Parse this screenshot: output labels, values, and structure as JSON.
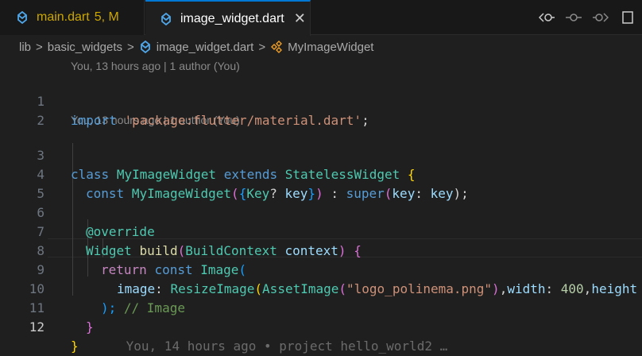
{
  "tabs": [
    {
      "name": "main.dart",
      "status": "5, M",
      "active": false
    },
    {
      "name": "image_widget.dart",
      "close": "✕",
      "active": true
    }
  ],
  "breadcrumb": {
    "items": [
      "lib",
      "basic_widgets",
      "image_widget.dart",
      "MyImageWidget"
    ],
    "separator": ">"
  },
  "blame": {
    "block1": "You, 13 hours ago | 1 author (You)",
    "block2": "You, 13 hours ago | 1 author (You)",
    "inline": "You, 14 hours ago • project hello_world2 …"
  },
  "line_numbers": [
    "1",
    "2",
    "3",
    "4",
    "5",
    "6",
    "7",
    "8",
    "9",
    "10",
    "11",
    "12"
  ],
  "code": {
    "l1": {
      "k": "import",
      "s": "'package:flutter/material.dart'",
      "p": ";"
    },
    "l3": {
      "k1": "class",
      "c": "MyImageWidget",
      "k2": "extends",
      "c2": "StatelessWidget",
      "b": "{"
    },
    "l4": {
      "k": "const",
      "c": "MyImageWidget",
      "p1": "(",
      "b": "{",
      "t": "Key",
      "q": "?",
      "v": "key",
      "b2": "}",
      "p2": ")",
      "p3": " : ",
      "s": "super",
      "p4": "(",
      "v2": "key",
      "p5": ": ",
      "v3": "key",
      "p6": ");"
    },
    "l6": {
      "a": "@override"
    },
    "l7": {
      "c": "Widget",
      "f": "build",
      "p1": "(",
      "c2": "BuildContext",
      "v": "context",
      "p2": ")",
      "b": "{"
    },
    "l8": {
      "r": "return",
      "k": "const",
      "c": "Image",
      "p": "("
    },
    "l9": {
      "v": "image",
      "p1": ": ",
      "c": "ResizeImage",
      "p2": "(",
      "c2": "AssetImage",
      "p3": "(",
      "s": "\"logo_polinema.png\"",
      "p4": ")",
      "p5": ",",
      "v2": "width",
      "p6": ": ",
      "n": "400",
      "p7": ",",
      "v3": "height"
    },
    "l10": {
      "p": ");",
      "cm": " // Image"
    },
    "l11": {
      "b": "}"
    },
    "l12": {
      "b": "}"
    }
  },
  "colors": {
    "background": "#1f1f1f",
    "accent": "#0078d4",
    "modified": "#cca700"
  }
}
